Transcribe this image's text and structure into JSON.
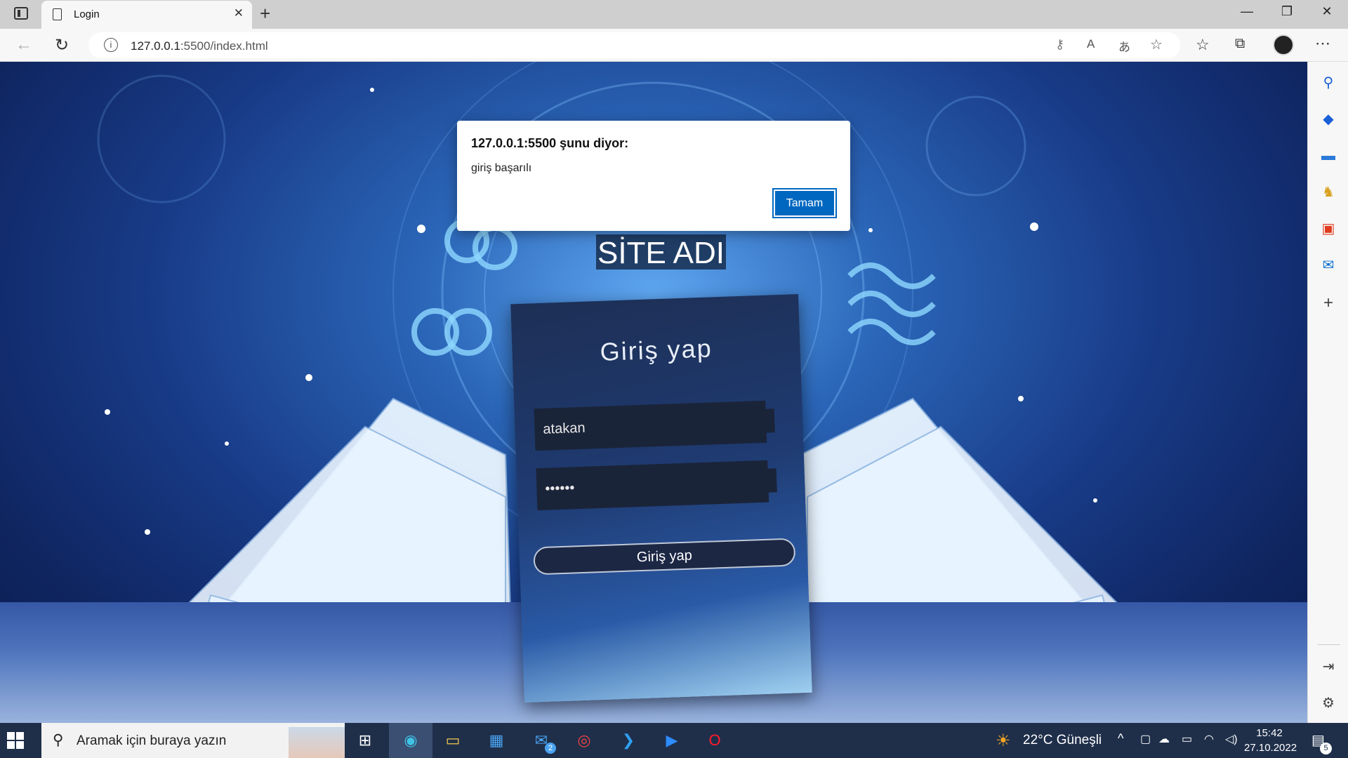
{
  "browser": {
    "tab_title": "Login",
    "url_host": "127.0.0.1",
    "url_rest": ":5500/index.html"
  },
  "alert": {
    "title": "127.0.0.1:5500 şunu diyor:",
    "message": "giriş başarılı",
    "ok_label": "Tamam"
  },
  "page": {
    "site_title": "SİTE ADI",
    "card_title": "Giriş yap",
    "username_value": "atakan",
    "password_value": "••••••",
    "login_label": "Giriş yap"
  },
  "taskbar": {
    "search_placeholder": "Aramak için buraya yazın",
    "weather": "22°C  Güneşli",
    "time": "15:42",
    "date": "27.10.2022",
    "mail_badge": "2",
    "notif_badge": "5"
  },
  "colors": {
    "dialog_button": "#0067c0",
    "taskbar": "#1f2f4a"
  }
}
